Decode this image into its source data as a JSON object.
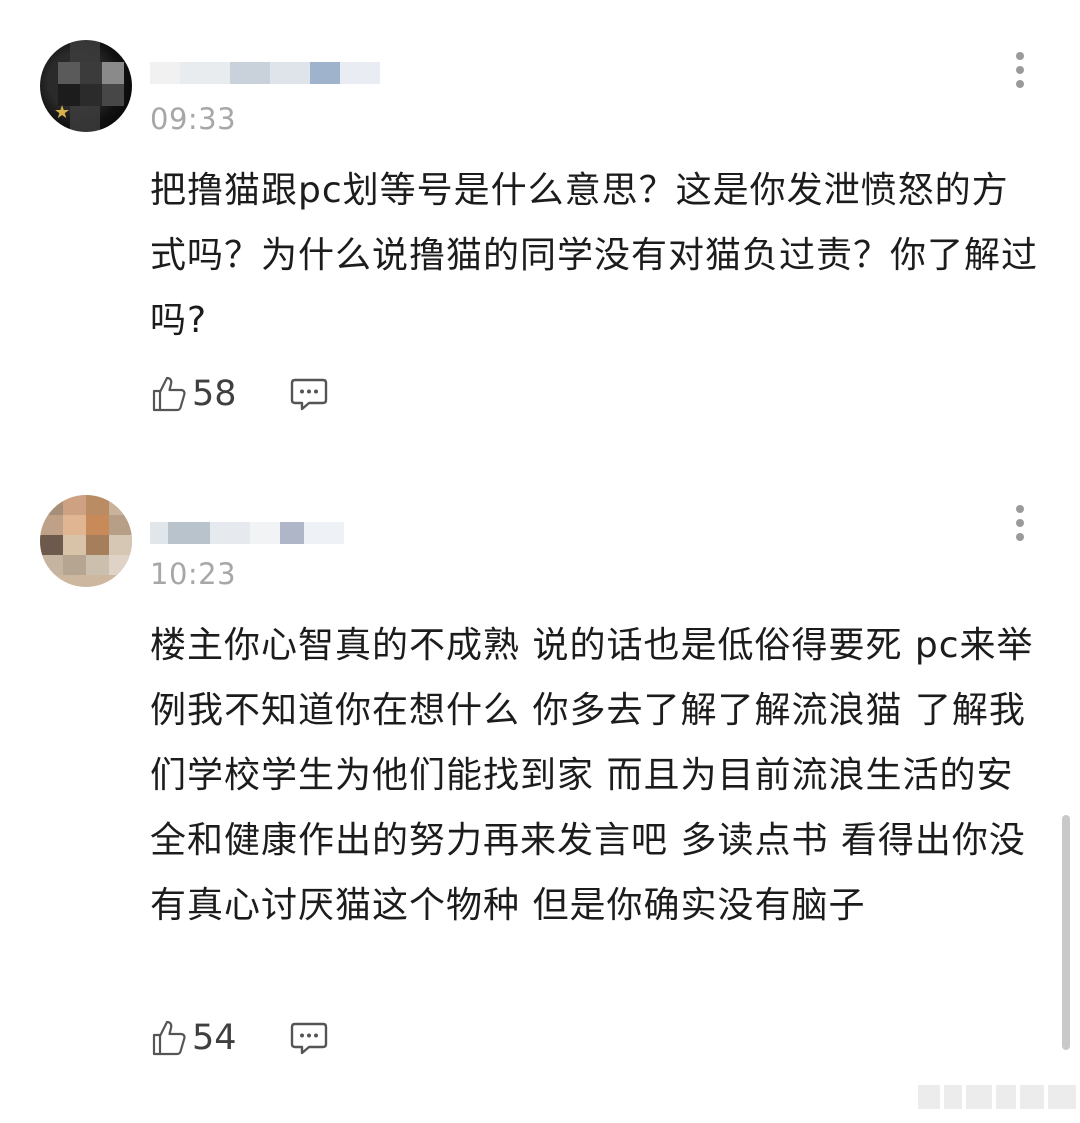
{
  "comments": [
    {
      "time": "09:33",
      "text": "把撸猫跟pc划等号是什么意思？这是你发泄愤怒的方式吗？为什么说撸猫的同学没有对猫负过责？你了解过吗?",
      "likes": "58"
    },
    {
      "time": "10:23",
      "text": "楼主你心智真的不成熟 说的话也是低俗得要死 pc来举例我不知道你在想什么 你多去了解了解流浪猫 了解我们学校学生为他们能找到家 而且为目前流浪生活的安全和健康作出的努力再来发言吧 多读点书 看得出你没有真心讨厌猫这个物种 但是你确实没有脑子",
      "likes": "54"
    }
  ],
  "icons": {
    "more": "more-vertical-icon",
    "like": "thumbs-up-icon",
    "reply": "comment-bubble-icon"
  },
  "colors": {
    "text": "#1c1c1c",
    "muted": "#a7a7a7",
    "icon": "#555555"
  }
}
